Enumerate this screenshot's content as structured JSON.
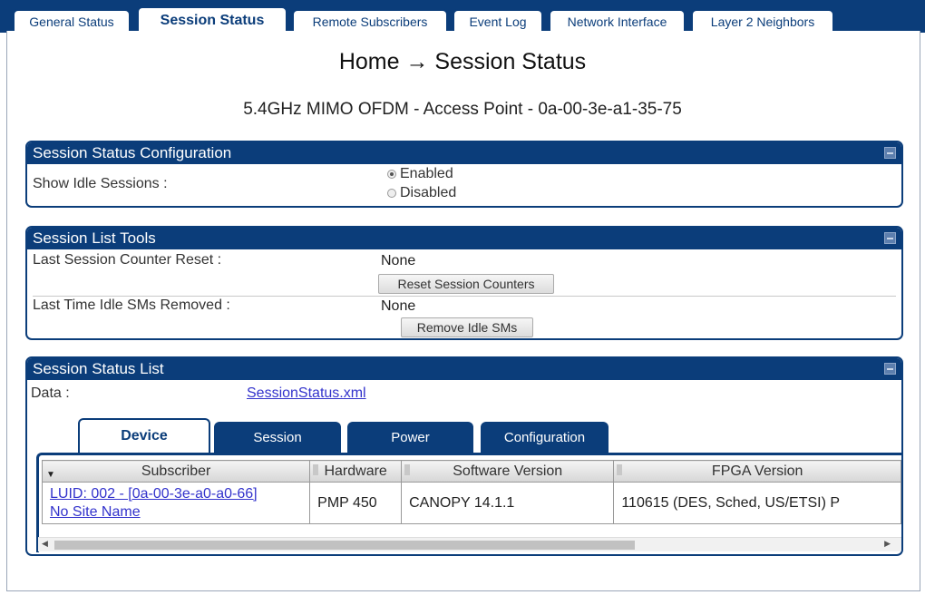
{
  "top_tabs": [
    {
      "label": "General Status"
    },
    {
      "label": "Session Status"
    },
    {
      "label": "Remote Subscribers"
    },
    {
      "label": "Event Log"
    },
    {
      "label": "Network Interface"
    },
    {
      "label": "Layer 2 Neighbors"
    }
  ],
  "active_top_tab": "Session Status",
  "page": {
    "breadcrumb": "Home → Session Status",
    "device_line": "5.4GHz MIMO OFDM - Access Point - 0a-00-3e-a1-35-75"
  },
  "session_config": {
    "title": "Session Status Configuration",
    "show_idle_label": "Show Idle Sessions :",
    "options": [
      {
        "label": "Enabled",
        "checked": true
      },
      {
        "label": "Disabled",
        "checked": false
      }
    ]
  },
  "session_tools": {
    "title": "Session List Tools",
    "counter_reset_label": "Last Session Counter Reset :",
    "counter_reset_value": "None",
    "reset_button": "Reset Session Counters",
    "idle_removed_label": "Last Time Idle SMs Removed :",
    "idle_removed_value": "None",
    "remove_button": "Remove Idle SMs"
  },
  "session_list": {
    "title": "Session Status List",
    "data_label": "Data :",
    "data_link": "SessionStatus.xml",
    "sub_tabs": [
      {
        "label": "Device"
      },
      {
        "label": "Session"
      },
      {
        "label": "Power"
      },
      {
        "label": "Configuration"
      }
    ],
    "active_sub_tab": "Device",
    "columns": [
      "Subscriber",
      "Hardware",
      "Software Version",
      "FPGA Version"
    ],
    "rows": [
      {
        "subscriber_line1": "LUID: 002 - [0a-00-3e-a0-a0-66]",
        "subscriber_line2": "No Site Name",
        "hardware": "PMP 450",
        "software": "CANOPY 14.1.1",
        "fpga": "110615 (DES, Sched, US/ETSI) P"
      }
    ]
  },
  "colors": {
    "primary": "#0b3d7a",
    "link": "#3333cc"
  }
}
